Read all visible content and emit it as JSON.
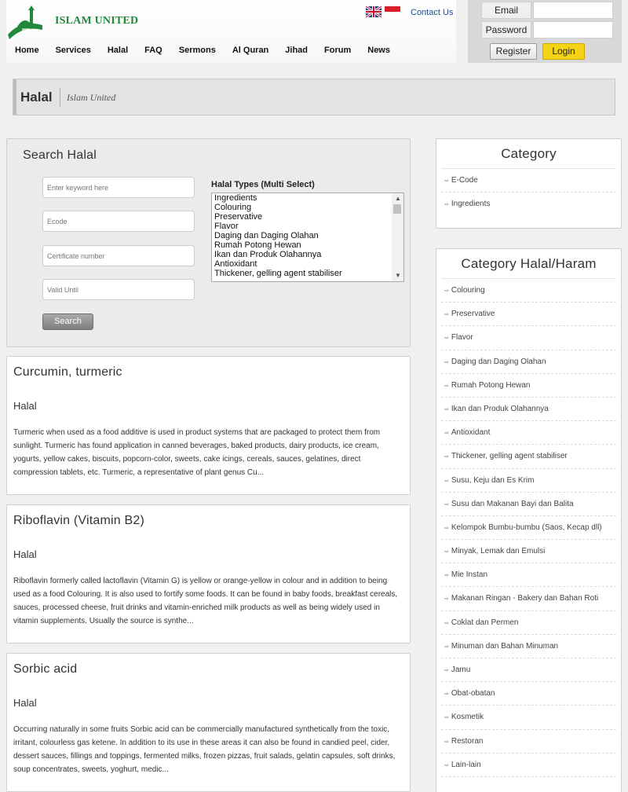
{
  "site": {
    "name": "ISLAM UNITED",
    "contact": "Contact Us"
  },
  "nav": [
    "Home",
    "Services",
    "Halal",
    "FAQ",
    "Sermons",
    "Al Quran",
    "Jihad",
    "Forum",
    "News"
  ],
  "login": {
    "email_label": "Email",
    "password_label": "Password",
    "register": "Register",
    "login": "Login"
  },
  "page": {
    "title": "Halal",
    "subtitle": "Islam United"
  },
  "search": {
    "title": "Search Halal",
    "keyword_placeholder": "Enter keyword here",
    "ecode_placeholder": "Ecode",
    "certificate_placeholder": "Certificate number",
    "valid_placeholder": "Valid Until",
    "types_label": "Halal Types (Multi Select)",
    "types": [
      "Ingredients",
      "Colouring",
      "Preservative",
      "Flavor",
      "Daging dan Daging Olahan",
      "Rumah Potong Hewan",
      "Ikan dan Produk Olahannya",
      "Antioxidant",
      "Thickener, gelling agent stabiliser"
    ],
    "button": "Search"
  },
  "results": [
    {
      "title": "Curcumin, turmeric",
      "status": "Halal",
      "description": "Turmeric when used as a food additive is used in product systems that are packaged to protect them from sunlight. Turmeric has found application in canned beverages, baked products, dairy products, ice cream, yogurts, yellow cakes, biscuits, popcorn-color, sweets, cake icings, cereals, sauces, gelatines, direct compression tablets, etc. Turmeric, a representative of plant genus Cu..."
    },
    {
      "title": "Riboflavin (Vitamin B2)",
      "status": "Halal",
      "description": "Riboflavin formerly called lactoflavin (Vitamin G) is yellow or orange-yellow in colour and in addition to being used as a food Colouring. It is also used to fortify some foods. It can be found in baby foods, breakfast cereals, sauces, processed cheese, fruit drinks and vitamin-enriched milk products as well as being widely used in vitamin supplements. Usually the source is synthe..."
    },
    {
      "title": "Sorbic acid",
      "status": "Halal",
      "description": "Occurring naturally in some fruits Sorbic acid can be commercially manufactured synthetically from the toxic, irritant, colourless gas ketene. In addition to its use in these areas it can also be found in candied peel, cider, dessert sauces, fillings and toppings, fermented milks, frozen pizzas, fruit salads, gelatin capsules, soft drinks, soup concentrates, sweets, yoghurt, medic..."
    }
  ],
  "category": {
    "title": "Category",
    "items": [
      "E-Code",
      "Ingredients"
    ]
  },
  "category_halal": {
    "title": "Category Halal/Haram",
    "items": [
      "Colouring",
      "Preservative",
      "Flavor",
      "Daging dan Daging Olahan",
      "Rumah Potong Hewan",
      "Ikan dan Produk Olahannya",
      "Antioxidant",
      "Thickener, gelling agent stabiliser",
      "Susu, Keju dan Es Krim",
      "Susu dan Makanan Bayi dan Balita",
      "Kelompok Bumbu-bumbu (Saos, Kecap dll)",
      "Minyak, Lemak dan Emulsi",
      "Mie Instan",
      "Makanan Ringan - Bakery dan Bahan Roti",
      "Coklat dan Permen",
      "Minuman dan Bahan Minuman",
      "Jamu",
      "Obat-obatan",
      "Kosmetik",
      "Restoran",
      "Lain-lain"
    ]
  }
}
